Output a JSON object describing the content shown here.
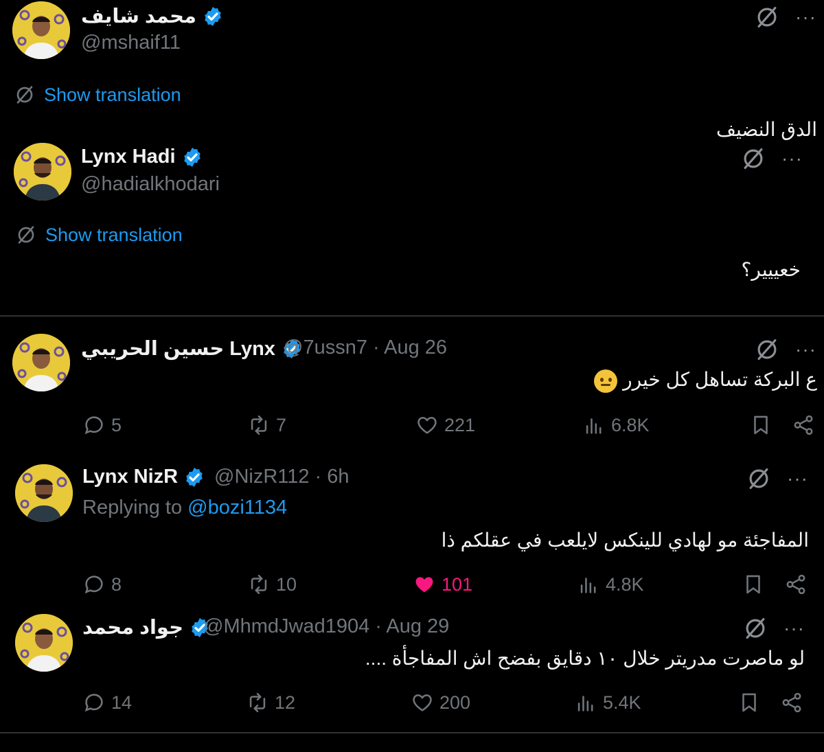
{
  "tweets": [
    {
      "name": "محمد شايف",
      "handle": "@mshaif11",
      "show_translation": "Show translation",
      "text": "الدق النضيف"
    },
    {
      "name": "Lynx Hadi",
      "handle": "@hadialkhodari",
      "show_translation": "Show translation",
      "text": "خعييير؟"
    },
    {
      "name": "حسين الحريبي Lynx",
      "handle": "@7ussn7 · Aug 26",
      "text": "ع البركة تساهل كل خيرر",
      "replies": "5",
      "retweets": "7",
      "likes": "221",
      "views": "6.8K"
    },
    {
      "name": "Lynx NizR",
      "handle": "@NizR112 · 6h",
      "replying_to_label": "Replying to ",
      "replying_to_user": "@bozi1134",
      "text": "المفاجئة مو لهادي للينكس لايلعب في عقلكم ذا",
      "replies": "8",
      "retweets": "10",
      "likes": "101",
      "views": "4.8K"
    },
    {
      "name": "جواد محمد",
      "handle": "@MhmdJwad1904 · Aug 29",
      "text": "لو ماصرت مدريتر خلال ١٠ دقايق بفضح اش المفاجأة ....",
      "replies": "14",
      "retweets": "12",
      "likes": "200",
      "views": "5.4K"
    }
  ],
  "menu_dots": "···",
  "colors": {
    "background": "#000000",
    "accent": "#1d9bf0",
    "muted": "#71767b",
    "like": "#f91880",
    "avatar_bg": "#e8c93a"
  },
  "icons": {
    "verified": "verified-badge-icon",
    "translate": "no-translate-icon",
    "reply": "reply-icon",
    "retweet": "retweet-icon",
    "like": "heart-icon",
    "views": "views-icon",
    "bookmark": "bookmark-icon",
    "share": "share-icon"
  }
}
